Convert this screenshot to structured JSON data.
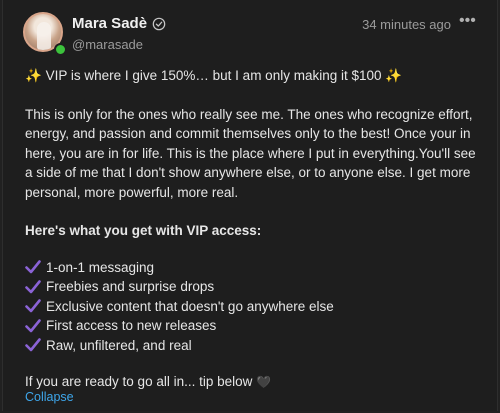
{
  "author": {
    "name": "Mara Sadè",
    "handle": "@marasade",
    "time": "34 minutes ago"
  },
  "post": {
    "headline": "VIP is where I give 150%… but I am only making it $100",
    "paragraph": "This is only for the ones who really see me. The ones who recognize effort, energy, and passion and commit themselves only to the best! Once your in here, you are in for life. This is the place where I put in everything.You'll see a side of me that I don't show anywhere else, or to anyone else. I get more personal, more powerful, more real.",
    "perks_heading": "Here's what you get with VIP access:",
    "perks": [
      "1-on-1 messaging",
      "Freebies and surprise drops",
      "Exclusive content that doesn't go anywhere else",
      "First access to new releases",
      "Raw, unfiltered, and real"
    ],
    "closing": "If you are ready to go all in... tip below",
    "collapse_label": "Collapse"
  },
  "icons": {
    "verified": "verified-badge-icon",
    "more": "more-options-icon",
    "check": "checkmark-icon",
    "sparkle": "sparkles-icon",
    "heart": "heart-icon"
  },
  "colors": {
    "background": "#1e1e1e",
    "link": "#3ea6ea",
    "check": "#8b63d6",
    "online": "#3cc23c"
  }
}
